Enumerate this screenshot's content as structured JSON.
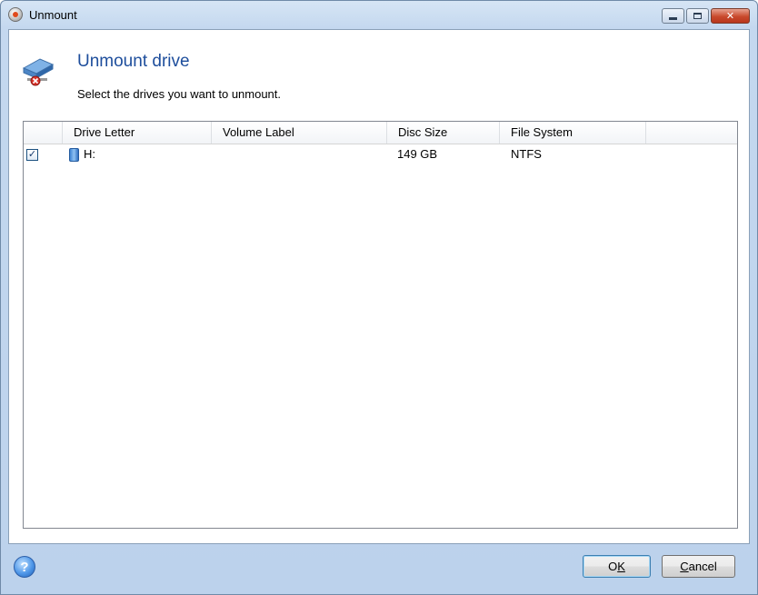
{
  "window": {
    "title": "Unmount",
    "icon": "acronis-app-icon"
  },
  "caption_buttons": {
    "minimize": "minimize-icon",
    "maximize": "maximize-icon",
    "close": "close-icon"
  },
  "header": {
    "title": "Unmount drive",
    "subtitle": "Select the drives you want to unmount.",
    "icon": "drive-unmount-icon"
  },
  "table": {
    "columns": [
      "",
      "Drive Letter",
      "Volume Label",
      "Disc Size",
      "File System",
      ""
    ],
    "rows": [
      {
        "checked": true,
        "drive_letter": "H:",
        "volume_label": "",
        "disc_size": "149 GB",
        "file_system": "NTFS",
        "icon": "hard-drive-icon"
      }
    ]
  },
  "footer": {
    "help_icon": "help-icon",
    "ok_label": "OK",
    "ok_accel": "K",
    "cancel_label": "Cancel",
    "cancel_accel": "C"
  },
  "colors": {
    "heading": "#1e4e9c",
    "frame": "#c4d8ef",
    "close_button": "#c94a2d"
  }
}
